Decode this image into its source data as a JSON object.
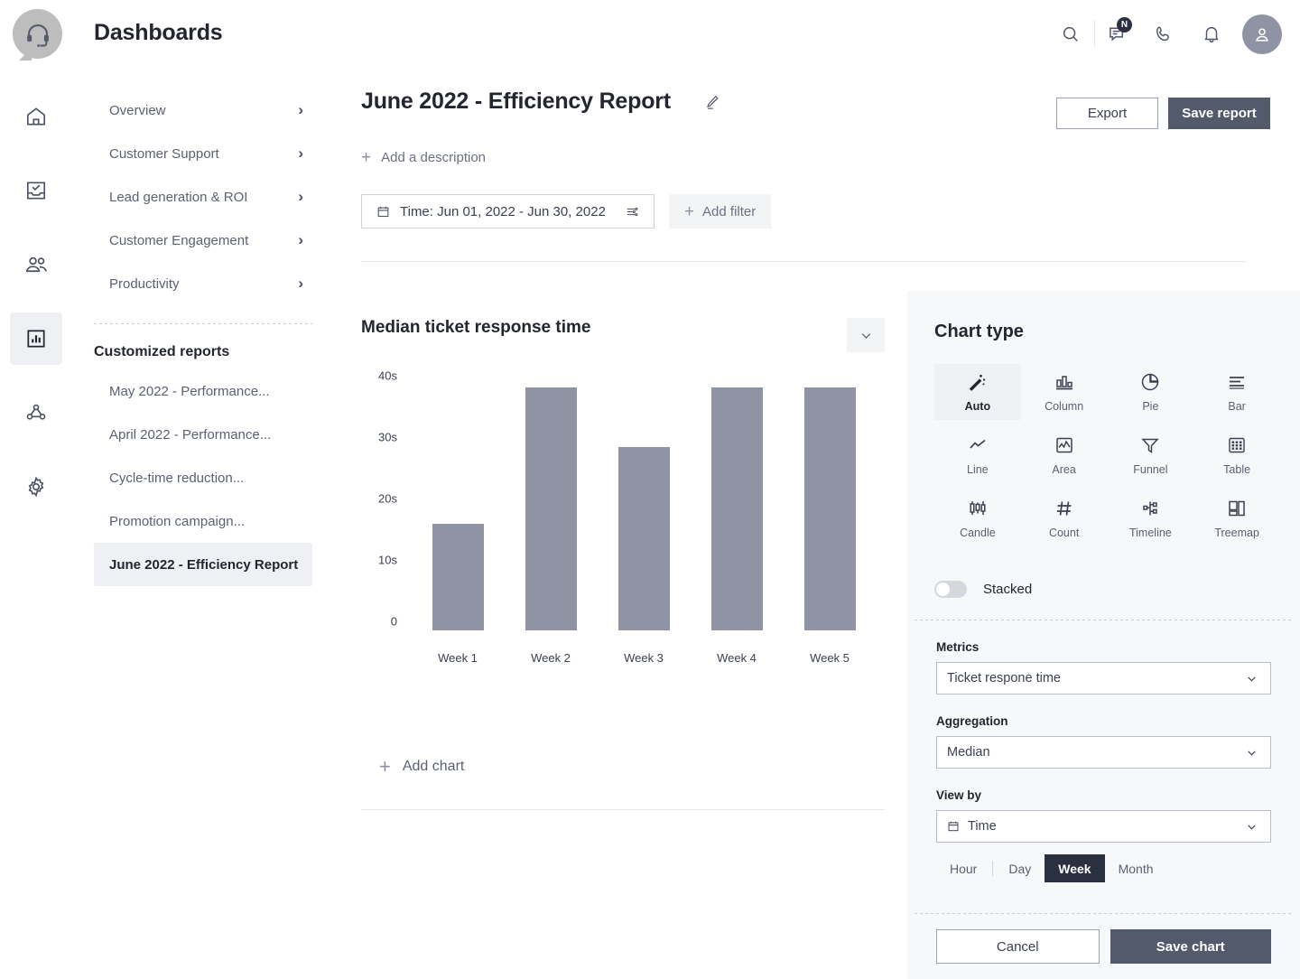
{
  "topbar": {
    "logo_icon": "headset-logo-icon",
    "title": "Dashboards",
    "icons": [
      {
        "name": "search-icon",
        "glyph": "search"
      },
      {
        "name": "messages-icon",
        "glyph": "chat",
        "badge": "N"
      },
      {
        "name": "phone-icon",
        "glyph": "phone"
      },
      {
        "name": "notifications-bell-icon",
        "glyph": "bell"
      },
      {
        "name": "user-avatar",
        "glyph": "user"
      }
    ]
  },
  "rail": {
    "items": [
      {
        "name": "rail-item-home",
        "icon": "home-icon",
        "active": false
      },
      {
        "name": "rail-item-tasks",
        "icon": "inbox-check-icon",
        "active": false
      },
      {
        "name": "rail-item-contacts",
        "icon": "people-icon",
        "active": false
      },
      {
        "name": "rail-item-dashboards",
        "icon": "bar-chart-icon",
        "active": true
      },
      {
        "name": "rail-item-automation",
        "icon": "nodes-icon",
        "active": false
      },
      {
        "name": "rail-item-settings",
        "icon": "gear-icon",
        "active": false
      }
    ]
  },
  "sidebar": {
    "sections": [
      {
        "label": "Overview"
      },
      {
        "label": "Customer Support"
      },
      {
        "label": "Lead generation & ROI"
      },
      {
        "label": "Customer Engagement"
      },
      {
        "label": "Productivity"
      }
    ],
    "customized_heading": "Customized reports",
    "reports": [
      {
        "label": "May 2022 - Performance...",
        "active": false
      },
      {
        "label": "April 2022 - Performance...",
        "active": false
      },
      {
        "label": "Cycle-time reduction...",
        "active": false
      },
      {
        "label": "Promotion campaign...",
        "active": false
      },
      {
        "label": "June 2022 - Efficiency Report",
        "active": true
      }
    ]
  },
  "report": {
    "title": "June 2022 - Efficiency Report",
    "edit_icon": "pencil-icon",
    "add_description_label": "Add a description",
    "export_label": "Export",
    "save_report_label": "Save report",
    "time_filter_label": "Time: Jun 01, 2022 - Jun 30, 2022",
    "add_filter_label": "Add filter",
    "add_chart_label": "Add chart"
  },
  "chart_data": {
    "type": "bar",
    "title": "Median ticket response time",
    "categories": [
      "Week 1",
      "Week 2",
      "Week 3",
      "Week 4",
      "Week 5"
    ],
    "values": [
      18,
      41,
      31,
      41,
      41
    ],
    "ytick_labels": [
      "40s",
      "30s",
      "20s",
      "10s",
      "0"
    ],
    "ytick_values": [
      40,
      30,
      20,
      10,
      0
    ],
    "ylim": [
      0,
      43
    ],
    "xlabel": "",
    "ylabel": "",
    "grid": false,
    "legend": false,
    "series_color": "#8f93a3"
  },
  "panel": {
    "title": "Chart type",
    "chart_types": [
      {
        "label": "Auto",
        "icon": "magic-wand-icon",
        "selected": true
      },
      {
        "label": "Column",
        "icon": "column-chart-icon",
        "selected": false
      },
      {
        "label": "Pie",
        "icon": "pie-chart-icon",
        "selected": false
      },
      {
        "label": "Bar",
        "icon": "bar-chart-icon",
        "selected": false
      },
      {
        "label": "Line",
        "icon": "line-chart-icon",
        "selected": false
      },
      {
        "label": "Area",
        "icon": "area-chart-icon",
        "selected": false
      },
      {
        "label": "Funnel",
        "icon": "funnel-icon",
        "selected": false
      },
      {
        "label": "Table",
        "icon": "table-icon",
        "selected": false
      },
      {
        "label": "Candle",
        "icon": "candlestick-icon",
        "selected": false
      },
      {
        "label": "Count",
        "icon": "hash-count-icon",
        "selected": false
      },
      {
        "label": "Timeline",
        "icon": "timeline-icon",
        "selected": false
      },
      {
        "label": "Treemap",
        "icon": "treemap-icon",
        "selected": false
      }
    ],
    "stacked_label": "Stacked",
    "stacked_on": false,
    "metrics_label": "Metrics",
    "metrics_value": "Ticket respone time",
    "aggregation_label": "Aggregation",
    "aggregation_value": "Median",
    "view_by_label": "View by",
    "view_by_value": "Time",
    "granularity": [
      {
        "label": "Hour",
        "active": false
      },
      {
        "label": "Day",
        "active": false
      },
      {
        "label": "Week",
        "active": true
      },
      {
        "label": "Month",
        "active": false
      }
    ],
    "cancel_label": "Cancel",
    "save_chart_label": "Save chart"
  },
  "colors": {
    "accent_dark": "#535a6b",
    "segment_active": "#2b3040",
    "bar": "#8f93a3",
    "panel_bg": "#f7f8fa"
  }
}
